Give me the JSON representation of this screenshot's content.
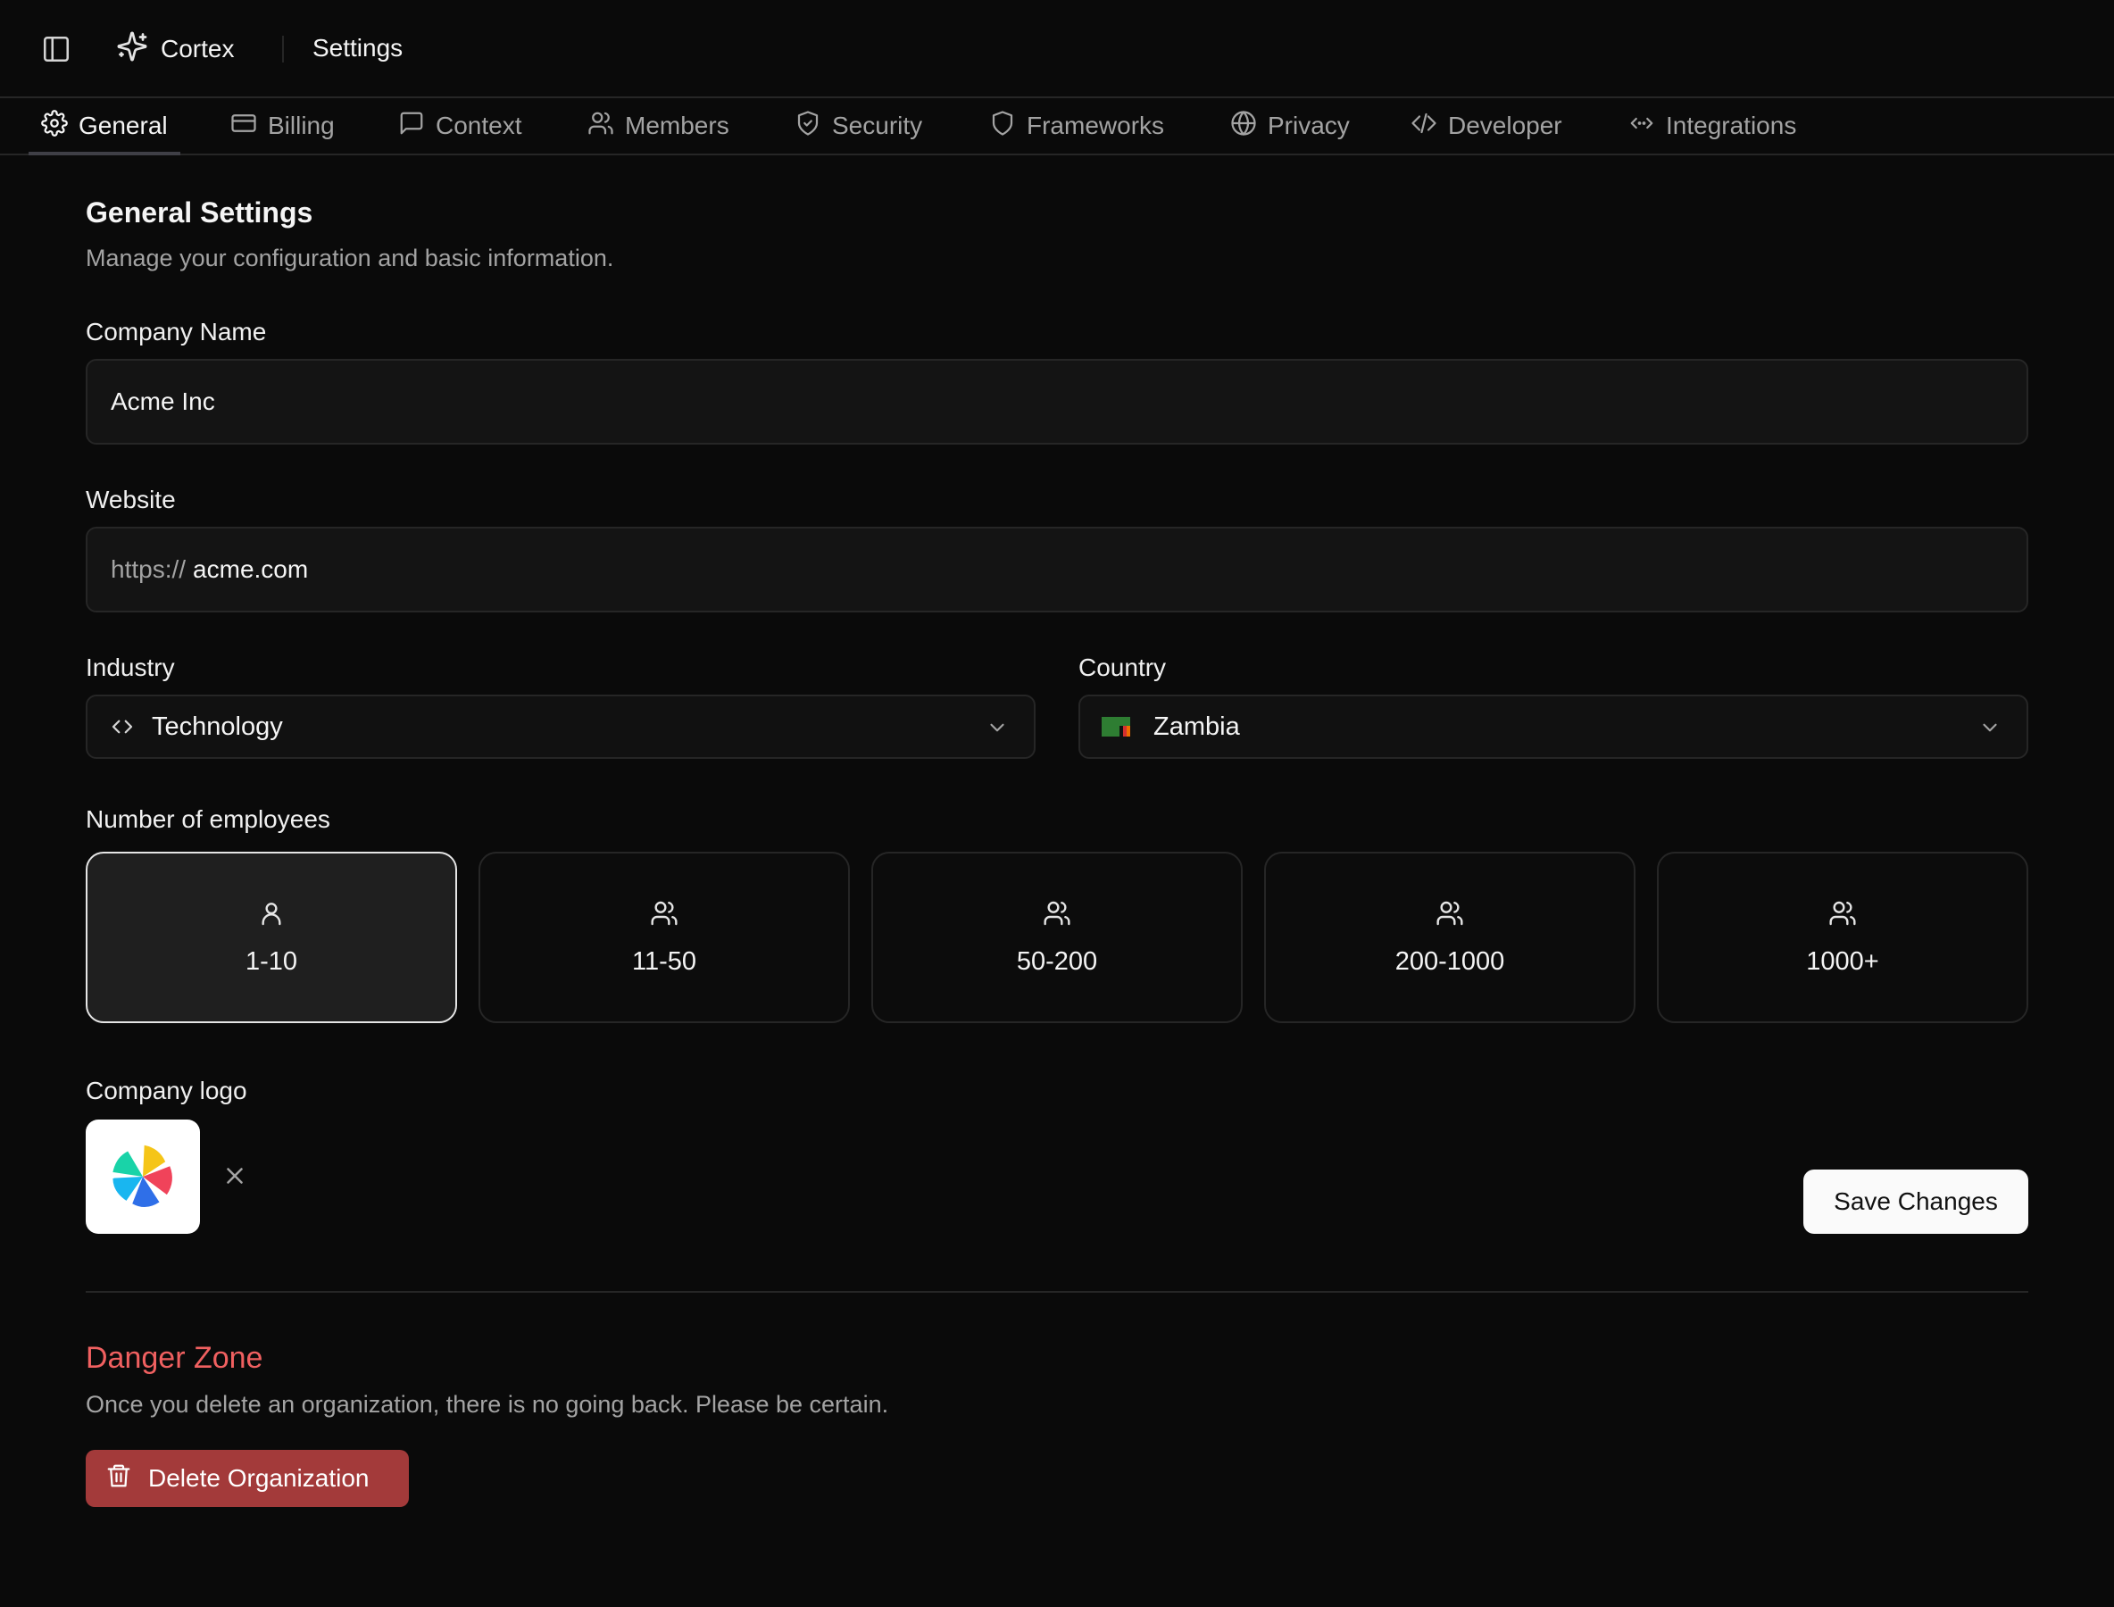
{
  "topbar": {
    "brand_name": "Cortex",
    "page_title": "Settings"
  },
  "tabs": [
    {
      "label": "General",
      "icon": "gear-icon",
      "active": true
    },
    {
      "label": "Billing",
      "icon": "credit-card-icon",
      "active": false
    },
    {
      "label": "Context",
      "icon": "message-square-icon",
      "active": false
    },
    {
      "label": "Members",
      "icon": "users-icon",
      "active": false
    },
    {
      "label": "Security",
      "icon": "shield-check-icon",
      "active": false
    },
    {
      "label": "Frameworks",
      "icon": "shield-icon",
      "active": false
    },
    {
      "label": "Privacy",
      "icon": "globe-lock-icon",
      "active": false
    },
    {
      "label": "Developer",
      "icon": "code-icon",
      "active": false
    },
    {
      "label": "Integrations",
      "icon": "code-xml-icon",
      "active": false
    }
  ],
  "general": {
    "title": "General Settings",
    "subtitle": "Manage your configuration and basic information."
  },
  "company_name": {
    "label": "Company Name",
    "value": "Acme Inc"
  },
  "website": {
    "label": "Website",
    "prefix": "https://",
    "value": "acme.com"
  },
  "industry": {
    "label": "Industry",
    "value": "Technology",
    "icon": "code-brackets-icon"
  },
  "country": {
    "label": "Country",
    "value": "Zambia",
    "icon": "zambia-flag-icon"
  },
  "employees": {
    "label": "Number of employees",
    "options": [
      {
        "label": "1-10",
        "icon": "user-icon",
        "selected": true
      },
      {
        "label": "11-50",
        "icon": "users-icon",
        "selected": false
      },
      {
        "label": "50-200",
        "icon": "users-icon",
        "selected": false
      },
      {
        "label": "200-1000",
        "icon": "users-icon",
        "selected": false
      },
      {
        "label": "1000+",
        "icon": "users-icon",
        "selected": false
      }
    ]
  },
  "logo": {
    "label": "Company logo"
  },
  "actions": {
    "save_label": "Save Changes"
  },
  "danger": {
    "title": "Danger Zone",
    "subtitle": "Once you delete an organization, there is no going back. Please be certain.",
    "delete_label": "Delete Organization"
  },
  "colors": {
    "background": "#0a0a0a",
    "border": "#262626",
    "danger_text": "#f06060",
    "danger_button": "#a33a3a"
  }
}
